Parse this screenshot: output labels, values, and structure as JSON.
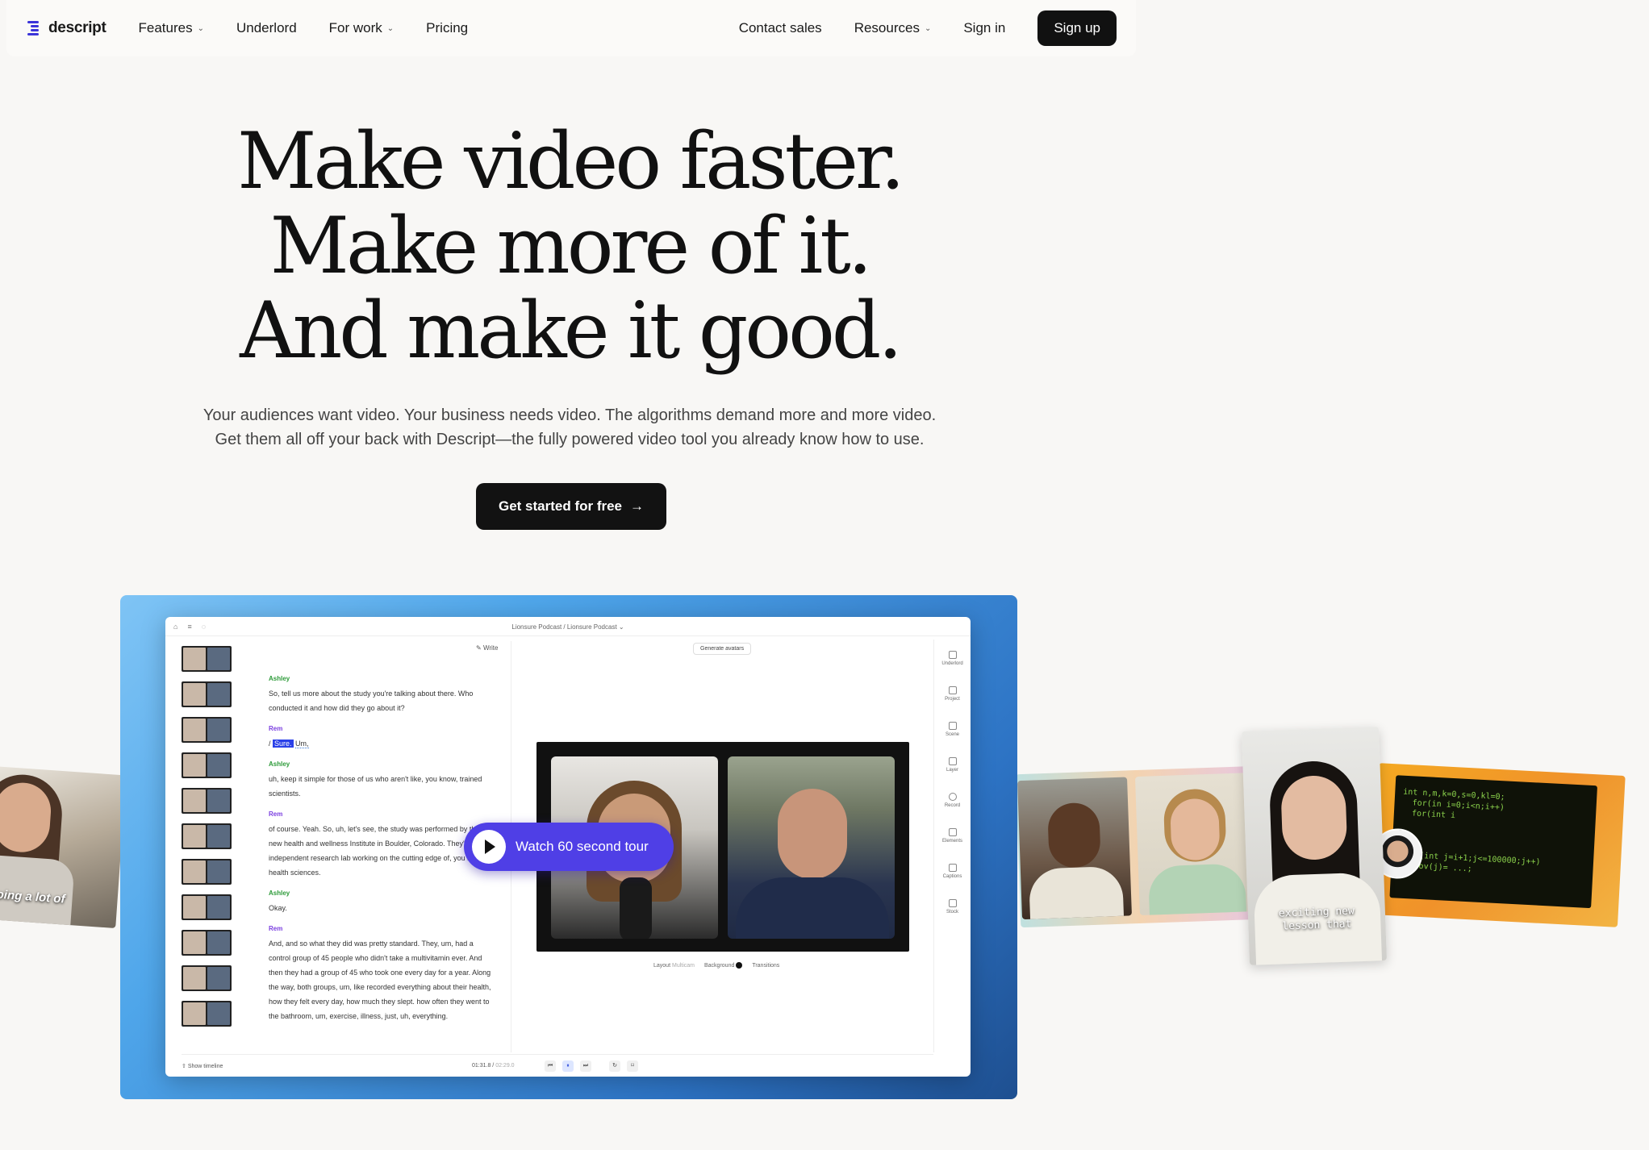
{
  "nav": {
    "logo_text": "descript",
    "items_left": [
      {
        "label": "Features",
        "dropdown": true
      },
      {
        "label": "Underlord",
        "dropdown": false
      },
      {
        "label": "For work",
        "dropdown": true
      },
      {
        "label": "Pricing",
        "dropdown": false
      }
    ],
    "contact": "Contact sales",
    "resources": "Resources",
    "sign_in": "Sign in",
    "sign_up": "Sign up",
    "brand_color": "#3b34d9"
  },
  "hero": {
    "line1": "Make video faster.",
    "line2": "Make more of it.",
    "line3": "And make it good.",
    "sub1": "Your audiences want video. Your business needs video. The algorithms demand more and more video.",
    "sub2": "Get them all off your back with Descript—the fully powered video tool you already know how to use.",
    "cta": "Get started for free",
    "cta_icon": "arrow-right-icon"
  },
  "app": {
    "breadcrumb": "Lionsure Podcast  /  Lionsure Podcast ⌄",
    "write": "Write",
    "generate_avatars": "Generate avatars",
    "transcript": [
      {
        "speaker": "Ashley",
        "text": "So, tell us more about the study you're talking about there. Who conducted it and how did they go about it?"
      },
      {
        "speaker": "Rem",
        "sure": "Sure.",
        "um": "Um,"
      },
      {
        "speaker": "Ashley",
        "text": "uh, keep it simple for those of us who aren't like, you know, trained scientists."
      },
      {
        "speaker": "Rem",
        "text": "of course. Yeah. So, uh, let's see, the study was performed by the new health and wellness Institute in Boulder, Colorado. They're an independent research lab working on the cutting edge of, you know, health sciences."
      },
      {
        "speaker": "Ashley",
        "text": "Okay."
      },
      {
        "speaker": "Rem",
        "text": "And, and so what they did was pretty standard. They, um, had a control group of 45 people who didn't take a multivitamin ever. And then they had a group of 45 who took one every day for a year. Along the way, both groups, um, like recorded everything about their health, how they felt every day, how much they slept. how often they went to the bathroom, um, exercise, illness, just, uh, everything."
      }
    ],
    "preview_options": {
      "layout": "Layout",
      "layout_value": "Multicam",
      "background": "Background",
      "transitions": "Transitions"
    },
    "tools": [
      "Underlord",
      "Project",
      "Scene",
      "Layer",
      "Record",
      "Elements",
      "Captions",
      "Stock"
    ],
    "show_timeline": "Show timeline",
    "time_current": "01:31.8",
    "time_total": "02:29.0",
    "watch_label": "Watch 60 second tour"
  },
  "cards": {
    "left_caption": "oing a lot of",
    "woman_caption_1": "exciting new",
    "woman_caption_2": "lesson that",
    "code_lines": "int n,m,k=0,s=0,kl=0;\n  for(in i=0;i<n;i++)\n  for(int i\n\n\n\n ...(int j=i+1;j<=100000;j++)\n  prov(j)= ...;"
  }
}
